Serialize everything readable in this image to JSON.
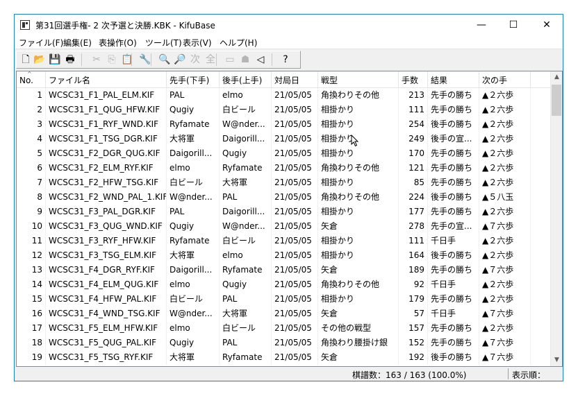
{
  "window": {
    "title": "第31回選手権- 2 次予選と決勝.KBK - KifuBase"
  },
  "controls": {
    "minimize": "—",
    "maximize": "☐",
    "close": "✕"
  },
  "menu": [
    "ファイル(F)",
    "編集(E)",
    "表操作(O)",
    "ツール(T)",
    "表示(V)",
    "ヘルプ(H)"
  ],
  "toolbar": {
    "buttons": [
      {
        "icon": "new-file-icon",
        "glyph": "🗋",
        "enabled": true
      },
      {
        "icon": "open-folder-icon",
        "glyph": "📂",
        "enabled": true
      },
      {
        "icon": "save-icon",
        "glyph": "💾",
        "enabled": true
      },
      {
        "icon": "print-icon",
        "glyph": "🖶",
        "enabled": true
      },
      {
        "icon": "cut-icon",
        "glyph": "✂",
        "enabled": false
      },
      {
        "icon": "copy-icon",
        "glyph": "⎘",
        "enabled": false
      },
      {
        "icon": "paste-icon",
        "glyph": "📋",
        "enabled": false
      },
      {
        "icon": "wrench-icon",
        "glyph": "🔧",
        "enabled": true
      },
      {
        "icon": "search-icon",
        "glyph": "🔍",
        "enabled": true
      },
      {
        "icon": "search-next-icon",
        "glyph": "🔎",
        "enabled": true
      },
      {
        "icon": "next-label-icon",
        "glyph": "次",
        "enabled": false
      },
      {
        "icon": "all-label-icon",
        "glyph": "全",
        "enabled": false
      },
      {
        "icon": "board-icon",
        "glyph": "▭",
        "enabled": false
      },
      {
        "icon": "piece-icon",
        "glyph": "☗",
        "enabled": false
      },
      {
        "icon": "speaker-icon",
        "glyph": "◁",
        "enabled": true
      },
      {
        "icon": "help-icon",
        "glyph": "?",
        "enabled": true
      }
    ]
  },
  "table": {
    "columns": [
      "No.",
      "ファイル名",
      "先手(下手)",
      "後手(上手)",
      "対局日",
      "戦型",
      "手数",
      "結果",
      "次の手"
    ],
    "rows": [
      [
        "1",
        "WCSC31_F1_PAL_ELM.KIF",
        "PAL",
        "elmo",
        "21/05/05",
        "角換わりその他",
        "213",
        "先手の勝ち",
        "▲２六歩"
      ],
      [
        "2",
        "WCSC31_F1_QUG_HFW.KIF",
        "Qugiy",
        "白ビール",
        "21/05/05",
        "相掛かり",
        "111",
        "先手の勝ち",
        "▲２六歩"
      ],
      [
        "3",
        "WCSC31_F1_RYF_WND.KIF",
        "Ryfamate",
        "W@nder...",
        "21/05/05",
        "相掛かり",
        "254",
        "後手の勝ち",
        "▲２六歩"
      ],
      [
        "4",
        "WCSC31_F1_TSG_DGR.KIF",
        "大将軍",
        "Daigorill...",
        "21/05/05",
        "相掛かり",
        "249",
        "後手の宣...",
        "▲２六歩"
      ],
      [
        "5",
        "WCSC31_F2_DGR_QUG.KIF",
        "Daigorill...",
        "Qugiy",
        "21/05/05",
        "相掛かり",
        "170",
        "先手の勝ち",
        "▲２六歩"
      ],
      [
        "6",
        "WCSC31_F2_ELM_RYF.KIF",
        "elmo",
        "Ryfamate",
        "21/05/05",
        "角換わりその他",
        "121",
        "先手の勝ち",
        "▲２六歩"
      ],
      [
        "7",
        "WCSC31_F2_HFW_TSG.KIF",
        "白ビール",
        "大将軍",
        "21/05/05",
        "相掛かり",
        "85",
        "先手の勝ち",
        "▲２六歩"
      ],
      [
        "8",
        "WCSC31_F2_WND_PAL_1.KIF",
        "W@nder...",
        "PAL",
        "21/05/05",
        "角換わりその他",
        "224",
        "後手の勝ち",
        "▲５八玉"
      ],
      [
        "9",
        "WCSC31_F3_PAL_DGR.KIF",
        "PAL",
        "Daigorill...",
        "21/05/05",
        "相掛かり",
        "177",
        "先手の勝ち",
        "▲２六歩"
      ],
      [
        "10",
        "WCSC31_F3_QUG_WND.KIF",
        "Qugiy",
        "W@nder...",
        "21/05/05",
        "矢倉",
        "278",
        "先手の宣...",
        "▲７六歩"
      ],
      [
        "11",
        "WCSC31_F3_RYF_HFW.KIF",
        "Ryfamate",
        "白ビール",
        "21/05/05",
        "相掛かり",
        "111",
        "千日手",
        "▲２六歩"
      ],
      [
        "12",
        "WCSC31_F3_TSG_ELM.KIF",
        "大将軍",
        "elmo",
        "21/05/05",
        "相掛かり",
        "164",
        "後手の勝ち",
        "▲２六歩"
      ],
      [
        "13",
        "WCSC31_F4_DGR_RYF.KIF",
        "Daigorill...",
        "Ryfamate",
        "21/05/05",
        "矢倉",
        "189",
        "先手の勝ち",
        "▲７六歩"
      ],
      [
        "14",
        "WCSC31_F4_ELM_QUG.KIF",
        "elmo",
        "Qugiy",
        "21/05/05",
        "角換わりその他",
        "92",
        "千日手",
        "▲２六歩"
      ],
      [
        "15",
        "WCSC31_F4_HFW_PAL.KIF",
        "白ビール",
        "PAL",
        "21/05/05",
        "相掛かり",
        "179",
        "先手の勝ち",
        "▲２六歩"
      ],
      [
        "16",
        "WCSC31_F4_WND_TSG.KIF",
        "W@nder...",
        "大将軍",
        "21/05/05",
        "矢倉",
        "57",
        "千日手",
        "▲７六歩"
      ],
      [
        "17",
        "WCSC31_F5_ELM_HFW.KIF",
        "elmo",
        "白ビール",
        "21/05/05",
        "その他の戦型",
        "157",
        "先手の勝ち",
        "▲２六歩"
      ],
      [
        "18",
        "WCSC31_F5_QUG_PAL.KIF",
        "Qugiy",
        "PAL",
        "21/05/05",
        "角換わり腰掛け銀",
        "152",
        "先手の勝ち",
        "▲７六歩"
      ],
      [
        "19",
        "WCSC31_F5_TSG_RYF.KIF",
        "大将軍",
        "Ryfamate",
        "21/05/05",
        "矢倉",
        "192",
        "後手の勝ち",
        "▲７六歩"
      ]
    ]
  },
  "status": {
    "count": "棋譜数：163 / 163 (100.0%)",
    "order": "表示順："
  }
}
